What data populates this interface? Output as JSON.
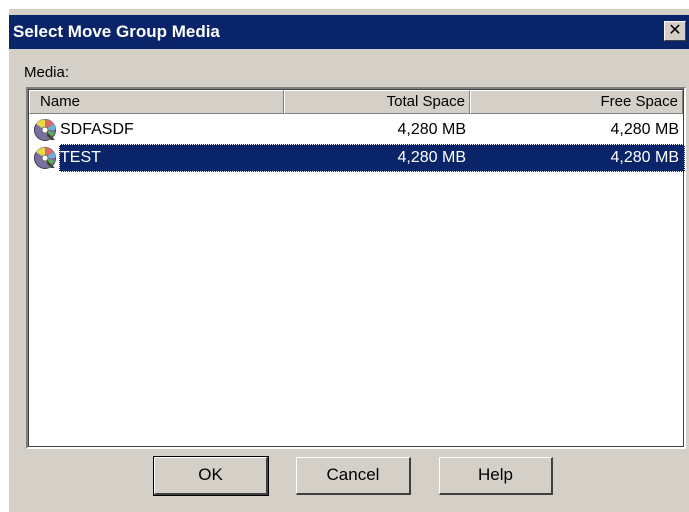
{
  "dialog": {
    "title": "Select Move Group Media",
    "close_label": "✕"
  },
  "media_label": "Media:",
  "list": {
    "columns": {
      "name": "Name",
      "total_space": "Total Space",
      "free_space": "Free Space"
    },
    "rows": [
      {
        "name": "SDFASDF",
        "total_space": "4,280 MB",
        "free_space": "4,280 MB",
        "selected": false,
        "icon": "media-disc-icon"
      },
      {
        "name": "TEST",
        "total_space": "4,280 MB",
        "free_space": "4,280 MB",
        "selected": true,
        "icon": "media-disc-icon"
      }
    ]
  },
  "buttons": {
    "ok": "OK",
    "cancel": "Cancel",
    "help": "Help"
  },
  "colors": {
    "titlebar": "#0a246a",
    "dialog_bg": "#d4d0c8",
    "selection": "#0a246a"
  }
}
